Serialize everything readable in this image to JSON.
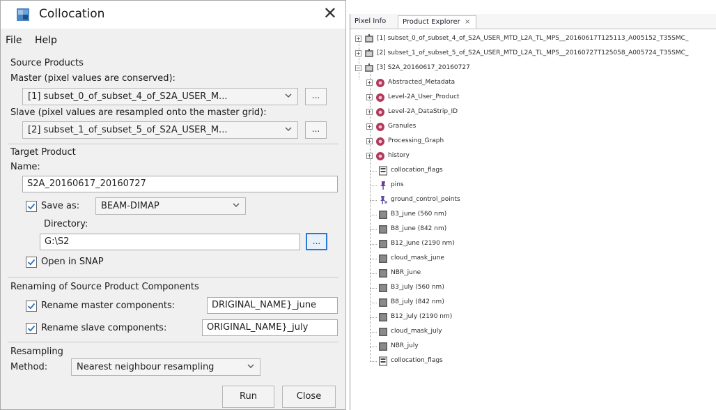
{
  "dialog": {
    "title": "Collocation",
    "close_glyph": "✕",
    "menu": [
      "File",
      "Help"
    ],
    "source_products": {
      "heading": "Source Products",
      "master_label": "Master (pixel values are conserved):",
      "master_value": "[1] subset_0_of_subset_4_of_S2A_USER_M...",
      "slave_label": "Slave (pixel values are resampled onto the master grid):",
      "slave_value": "[2] subset_1_of_subset_5_of_S2A_USER_M...",
      "browse": "..."
    },
    "target_product": {
      "heading": "Target Product",
      "name_label": "Name:",
      "name_value": "S2A_20160617_20160727",
      "save_as_label": "Save as:",
      "save_as_checked": true,
      "format_value": "BEAM-DIMAP",
      "directory_label": "Directory:",
      "directory_value": "G:\\S2",
      "browse": "...",
      "open_in_snap_label": "Open in SNAP",
      "open_in_snap_checked": true
    },
    "renaming": {
      "heading": "Renaming of Source Product Components",
      "master_label": "Rename master components:",
      "master_checked": true,
      "master_value": "DRIGINAL_NAME}_june",
      "slave_label": "Rename slave components:",
      "slave_checked": true,
      "slave_value": "ORIGINAL_NAME}_july"
    },
    "resampling": {
      "heading": "Resampling",
      "method_label": "Method:",
      "method_value": "Nearest neighbour resampling"
    },
    "buttons": {
      "run": "Run",
      "close": "Close"
    }
  },
  "explorer": {
    "tabs": [
      {
        "label": "Pixel Info"
      },
      {
        "label": "Product Explorer",
        "close": "×"
      }
    ],
    "products": [
      {
        "label": "[1] subset_0_of_subset_4_of_S2A_USER_MTD_L2A_TL_MPS__20160617T125113_A005152_T35SMC_"
      },
      {
        "label": "[2] subset_1_of_subset_5_of_S2A_USER_MTD_L2A_TL_MPS__20160727T125058_A005724_T35SMC_"
      },
      {
        "label": "[3] S2A_20160617_20160727"
      }
    ],
    "groups": [
      "Abstracted_Metadata",
      "Level-2A_User_Product",
      "Level-2A_DataStrip_ID",
      "Granules",
      "Processing_Graph",
      "history"
    ],
    "items": [
      {
        "label": "collocation_flags",
        "icon": "flag-band-icon"
      },
      {
        "label": "pins",
        "icon": "pin-icon"
      },
      {
        "label": "ground_control_points",
        "icon": "gcp-icon"
      },
      {
        "label": "B3_june (560 nm)",
        "icon": "band-icon"
      },
      {
        "label": "B8_june (842 nm)",
        "icon": "band-icon"
      },
      {
        "label": "B12_june (2190 nm)",
        "icon": "band-icon"
      },
      {
        "label": "cloud_mask_june",
        "icon": "band-icon"
      },
      {
        "label": "NBR_june",
        "icon": "band-icon"
      },
      {
        "label": "B3_july (560 nm)",
        "icon": "band-icon"
      },
      {
        "label": "B8_july (842 nm)",
        "icon": "band-icon"
      },
      {
        "label": "B12_july (2190 nm)",
        "icon": "band-icon"
      },
      {
        "label": "cloud_mask_july",
        "icon": "band-icon"
      },
      {
        "label": "NBR_july",
        "icon": "band-icon"
      },
      {
        "label": "collocation_flags",
        "icon": "flag-band-icon"
      }
    ]
  }
}
